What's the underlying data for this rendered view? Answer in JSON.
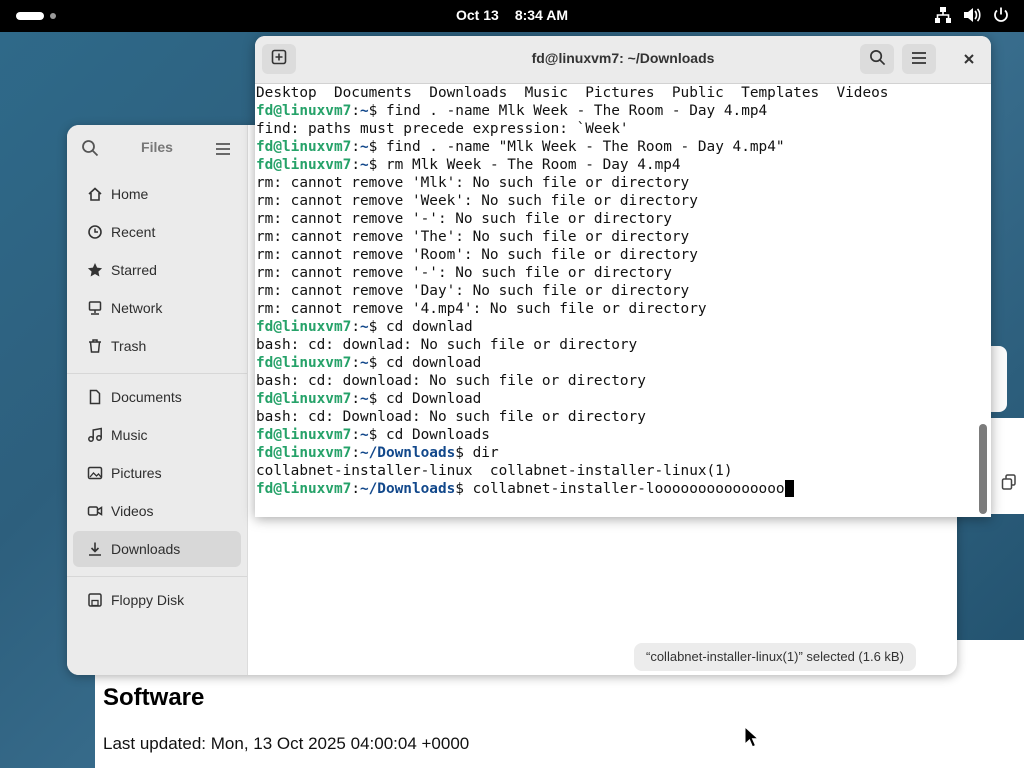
{
  "topbar": {
    "date": "Oct 13",
    "time": "8:34 AM"
  },
  "software": {
    "title": "Software",
    "last_updated": "Last updated: Mon, 13 Oct 2025 04:00:04 +0000"
  },
  "files": {
    "title": "Files",
    "places": [
      {
        "label": "Home",
        "icon": "home-icon"
      },
      {
        "label": "Recent",
        "icon": "clock-icon"
      },
      {
        "label": "Starred",
        "icon": "star-icon"
      },
      {
        "label": "Network",
        "icon": "network-icon"
      },
      {
        "label": "Trash",
        "icon": "trash-icon"
      }
    ],
    "bookmarks": [
      {
        "label": "Documents",
        "icon": "document-icon"
      },
      {
        "label": "Music",
        "icon": "music-icon"
      },
      {
        "label": "Pictures",
        "icon": "picture-icon"
      },
      {
        "label": "Videos",
        "icon": "video-icon"
      },
      {
        "label": "Downloads",
        "icon": "download-icon",
        "active": true
      }
    ],
    "devices": [
      {
        "label": "Floppy Disk",
        "icon": "floppy-icon"
      }
    ],
    "status": "“collabnet-installer-linux(1)” selected  (1.6 kB)"
  },
  "terminal": {
    "title": "fd@linuxvm7: ~/Downloads",
    "lines": [
      {
        "out": "Desktop  Documents  Downloads  Music  Pictures  Public  Templates  Videos"
      },
      {
        "user": "fd@linuxvm7",
        "path": "~",
        "cmd": "find . -name Mlk Week - The Room - Day 4.mp4"
      },
      {
        "out": "find: paths must precede expression: `Week'"
      },
      {
        "user": "fd@linuxvm7",
        "path": "~",
        "cmd": "find . -name \"Mlk Week - The Room - Day 4.mp4\""
      },
      {
        "user": "fd@linuxvm7",
        "path": "~",
        "cmd": "rm Mlk Week - The Room - Day 4.mp4"
      },
      {
        "out": "rm: cannot remove 'Mlk': No such file or directory"
      },
      {
        "out": "rm: cannot remove 'Week': No such file or directory"
      },
      {
        "out": "rm: cannot remove '-': No such file or directory"
      },
      {
        "out": "rm: cannot remove 'The': No such file or directory"
      },
      {
        "out": "rm: cannot remove 'Room': No such file or directory"
      },
      {
        "out": "rm: cannot remove '-': No such file or directory"
      },
      {
        "out": "rm: cannot remove 'Day': No such file or directory"
      },
      {
        "out": "rm: cannot remove '4.mp4': No such file or directory"
      },
      {
        "user": "fd@linuxvm7",
        "path": "~",
        "cmd": "cd downlad"
      },
      {
        "out": "bash: cd: downlad: No such file or directory"
      },
      {
        "user": "fd@linuxvm7",
        "path": "~",
        "cmd": "cd download"
      },
      {
        "out": "bash: cd: download: No such file or directory"
      },
      {
        "user": "fd@linuxvm7",
        "path": "~",
        "cmd": "cd Download"
      },
      {
        "out": "bash: cd: Download: No such file or directory"
      },
      {
        "user": "fd@linuxvm7",
        "path": "~",
        "cmd": "cd Downloads"
      },
      {
        "user": "fd@linuxvm7",
        "path": "~/Downloads",
        "cmd": "dir"
      },
      {
        "out": "collabnet-installer-linux  collabnet-installer-linux(1)"
      },
      {
        "user": "fd@linuxvm7",
        "path": "~/Downloads",
        "cmd": "collabnet-installer-looooooooooooooo",
        "cursor": true
      }
    ]
  }
}
